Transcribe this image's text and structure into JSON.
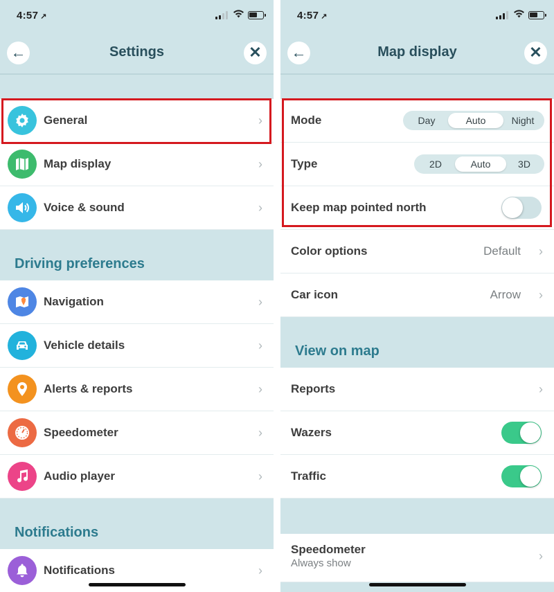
{
  "status_bar": {
    "time": "4:57",
    "location_glyph": "↗"
  },
  "left": {
    "title": "Settings",
    "back_glyph": "←",
    "close_glyph": "✕",
    "top_items": [
      {
        "label": "General",
        "icon": "gear-icon",
        "color": "#38c3dd"
      },
      {
        "label": "Map display",
        "icon": "map-icon",
        "color": "#3dbb6d"
      },
      {
        "label": "Voice & sound",
        "icon": "speaker-icon",
        "color": "#36b7e8"
      }
    ],
    "driving_section": "Driving preferences",
    "driving_items": [
      {
        "label": "Navigation",
        "icon": "navigation-icon",
        "color": "#4e86e4"
      },
      {
        "label": "Vehicle details",
        "icon": "car-icon",
        "color": "#22b2dc"
      },
      {
        "label": "Alerts & reports",
        "icon": "alert-pin-icon",
        "color": "#f3921f"
      },
      {
        "label": "Speedometer",
        "icon": "speedometer-icon",
        "color": "#ec6a43"
      },
      {
        "label": "Audio player",
        "icon": "music-note-icon",
        "color": "#ec4488"
      }
    ],
    "notifications_section": "Notifications",
    "notification_items": [
      {
        "label": "Notifications",
        "icon": "bell-icon",
        "color": "#9b5fd8"
      }
    ]
  },
  "right": {
    "title": "Map display",
    "back_glyph": "←",
    "close_glyph": "✕",
    "mode": {
      "label": "Mode",
      "options": [
        "Day",
        "Auto",
        "Night"
      ],
      "selected": "Auto"
    },
    "type": {
      "label": "Type",
      "options": [
        "2D",
        "Auto",
        "3D"
      ],
      "selected": "Auto"
    },
    "keep_north": {
      "label": "Keep map pointed north",
      "on": false
    },
    "color_options": {
      "label": "Color options",
      "value": "Default"
    },
    "car_icon": {
      "label": "Car icon",
      "value": "Arrow"
    },
    "view_section": "View on map",
    "reports": {
      "label": "Reports"
    },
    "wazers": {
      "label": "Wazers",
      "on": true
    },
    "traffic": {
      "label": "Traffic",
      "on": true
    },
    "speedometer": {
      "label": "Speedometer",
      "sublabel": "Always show"
    }
  },
  "chevron_glyph": "›",
  "colors": {
    "toggle_on": "#3ac98a",
    "highlight": "#d5191f",
    "header_text": "#294f5c",
    "section_text": "#2d7b8e"
  }
}
